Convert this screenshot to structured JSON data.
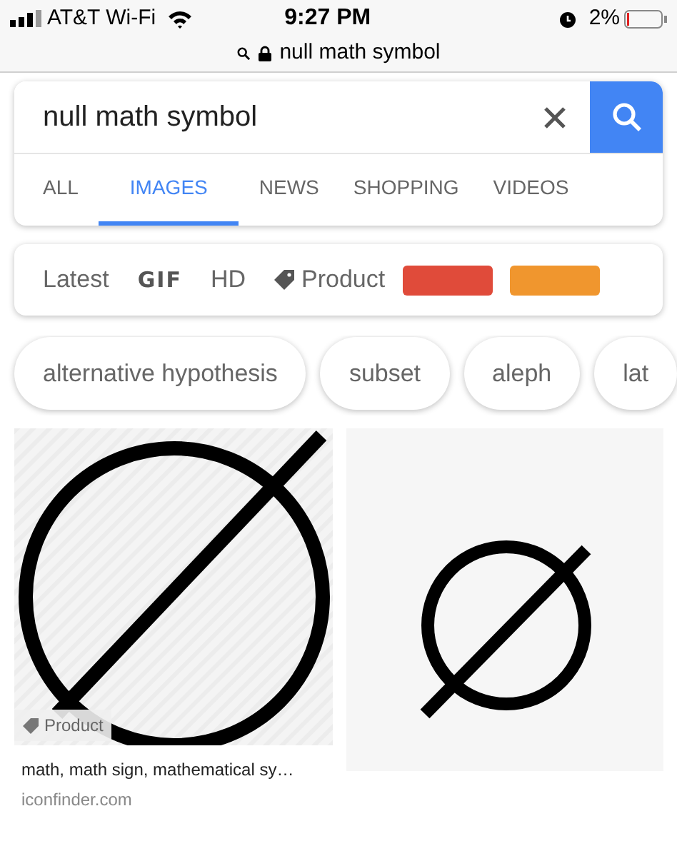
{
  "status_bar": {
    "carrier": "AT&T Wi-Fi",
    "time": "9:27 PM",
    "battery": "2%"
  },
  "address_bar": {
    "url": "null math symbol"
  },
  "search": {
    "value": "null math symbol"
  },
  "tabs": [
    {
      "label": "ALL",
      "selected": false
    },
    {
      "label": "IMAGES",
      "selected": true
    },
    {
      "label": "NEWS",
      "selected": false
    },
    {
      "label": "SHOPPING",
      "selected": false
    },
    {
      "label": "VIDEOS",
      "selected": false
    }
  ],
  "filters": [
    {
      "kind": "text",
      "label": "Latest"
    },
    {
      "kind": "gif",
      "label": "GIF"
    },
    {
      "kind": "text",
      "label": "HD"
    },
    {
      "kind": "tag",
      "label": "Product"
    },
    {
      "kind": "color",
      "color": "#e04b3a"
    },
    {
      "kind": "color",
      "color": "#f0962e"
    }
  ],
  "suggestions": [
    "alternative hypothesis",
    "subset",
    "aleph",
    "lat"
  ],
  "results": [
    {
      "kind": "picture",
      "badge": "Product",
      "title": "math, math sign, mathematical sy…",
      "source": "iconfinder.com"
    },
    {
      "kind": "picture"
    }
  ]
}
